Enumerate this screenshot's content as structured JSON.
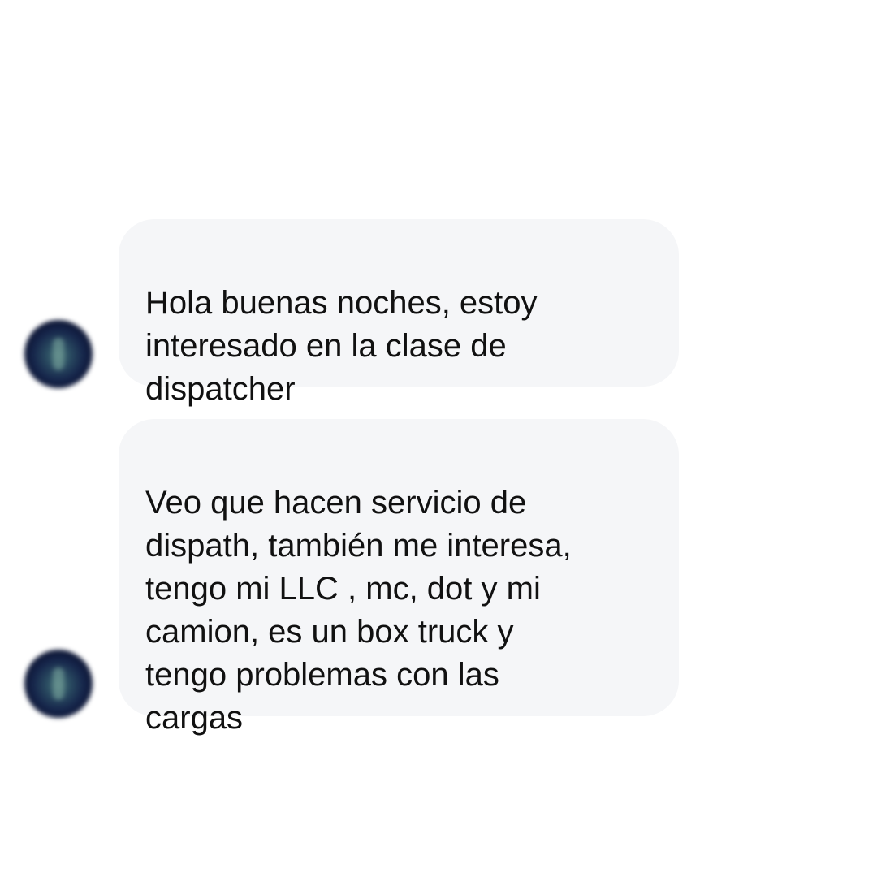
{
  "conversation": {
    "messages": [
      {
        "sender": "incoming",
        "text": "Hola buenas noches, estoy\ninteresado en la clase de\ndispatcher"
      },
      {
        "sender": "incoming",
        "text": "Veo que hacen servicio de\ndispath, también me interesa,\ntengo mi LLC , mc, dot y mi\ncamion, es un box truck y\ntengo problemas con las\ncargas"
      }
    ],
    "colors": {
      "bubble_background": "#f5f6f8",
      "text": "#111111",
      "page_background": "#ffffff"
    }
  }
}
